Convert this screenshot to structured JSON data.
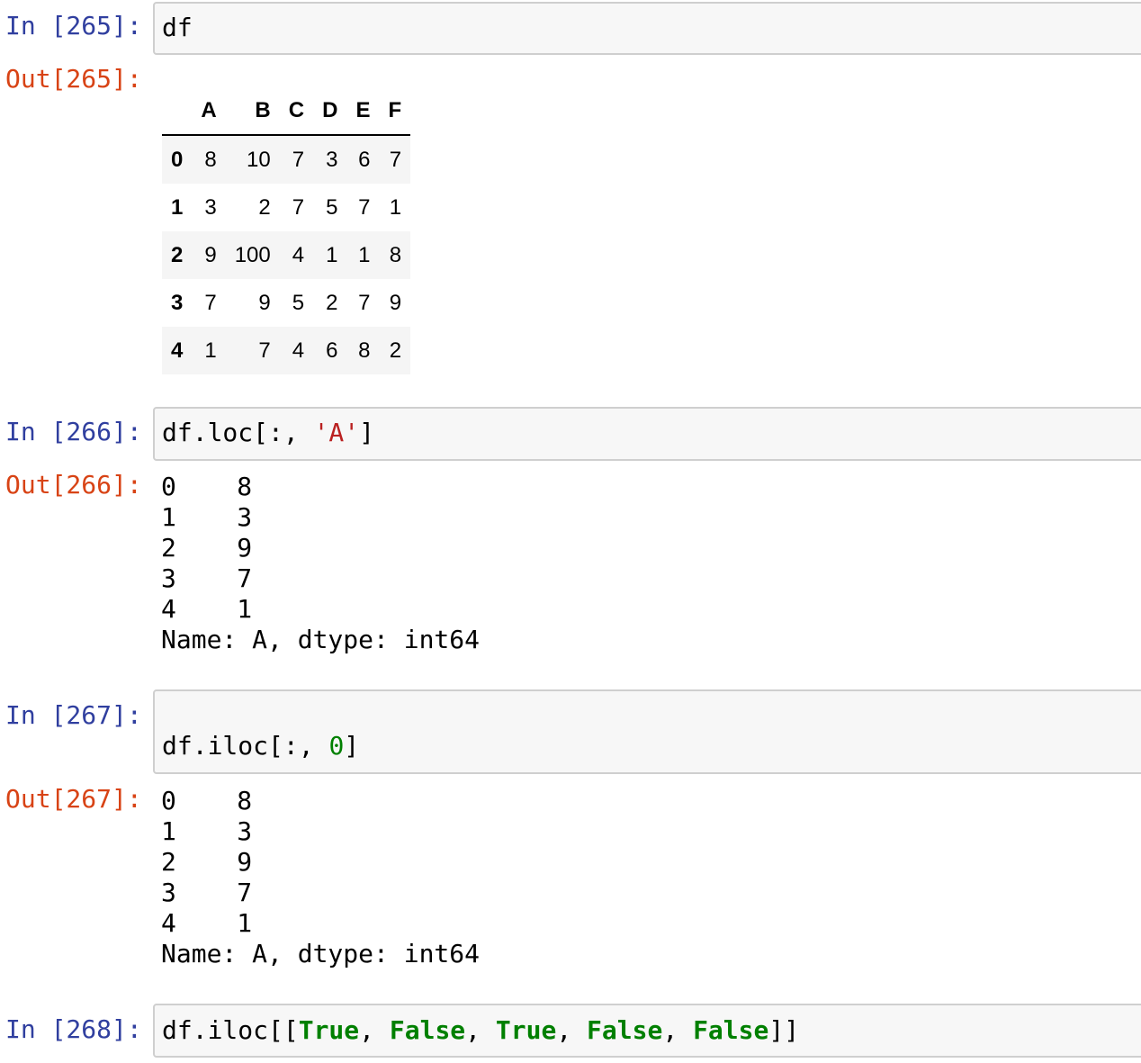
{
  "cells": [
    {
      "in_prompt": "In [265]:",
      "code": "df",
      "out_prompt": "Out[265]:",
      "table": {
        "columns": [
          "A",
          "B",
          "C",
          "D",
          "E",
          "F"
        ],
        "rows": [
          {
            "index": "0",
            "values": [
              "8",
              "10",
              "7",
              "3",
              "6",
              "7"
            ]
          },
          {
            "index": "1",
            "values": [
              "3",
              "2",
              "7",
              "5",
              "7",
              "1"
            ]
          },
          {
            "index": "2",
            "values": [
              "9",
              "100",
              "4",
              "1",
              "1",
              "8"
            ]
          },
          {
            "index": "3",
            "values": [
              "7",
              "9",
              "5",
              "2",
              "7",
              "9"
            ]
          },
          {
            "index": "4",
            "values": [
              "1",
              "7",
              "4",
              "6",
              "8",
              "2"
            ]
          }
        ]
      }
    },
    {
      "in_prompt": "In [266]:",
      "code_prefix": "df.loc[:, ",
      "code_string": "'A'",
      "code_suffix": "]",
      "out_prompt": "Out[266]:",
      "series_text": "0    8\n1    3\n2    9\n3    7\n4    1\nName: A, dtype: int64"
    },
    {
      "in_prompt": "In [267]:",
      "code_prefix": "df.iloc[:, ",
      "code_number": "0",
      "code_suffix": "]",
      "out_prompt": "Out[267]:",
      "series_text": "0    8\n1    3\n2    9\n3    7\n4    1\nName: A, dtype: int64"
    },
    {
      "in_prompt": "In [268]:",
      "code_parts": {
        "p0": "df.iloc[[",
        "k1": "True",
        "p1": ", ",
        "k2": "False",
        "p2": ", ",
        "k3": "True",
        "p3": ", ",
        "k4": "False",
        "p4": ", ",
        "k5": "False",
        "p5": "]]"
      }
    }
  ]
}
